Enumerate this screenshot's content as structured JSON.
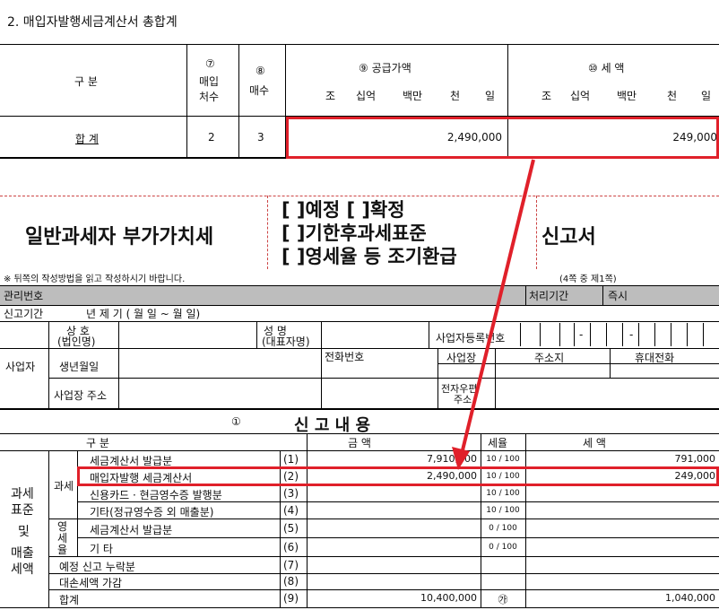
{
  "section_title": "2. 매입자발행세금계산서 총합계",
  "summary_table": {
    "col_category": "구  분",
    "col7_num": "⑦",
    "col7_label_1": "매입",
    "col7_label_2": "처수",
    "col8_num": "⑧",
    "col8_label": "매수",
    "col9_label": "⑨ 공급가액",
    "col10_label": "⑩ 세  액",
    "units": [
      "조",
      "십억",
      "백만",
      "천",
      "일"
    ],
    "row_label": "합  계",
    "row_vendors": "2",
    "row_count": "3",
    "row_supply": "2,490,000",
    "row_tax": "249,000"
  },
  "form_title": {
    "left": "일반과세자 부가가치세",
    "opt1": "[ ]예정 [ ]확정",
    "opt2": "[ ]기한후과세표준",
    "opt3": "[ ]영세율 등 조기환급",
    "right": "신고서"
  },
  "notice": "※ 뒤쪽의 작성방법을 읽고 작성하시기 바랍니다.",
  "page_info": "(4쪽 중 제1쪽)",
  "mgmt_no": "관리번호",
  "proc_period": "처리기간",
  "proc_value": "즉시",
  "period_label": "신고기간",
  "period_value": "년  제  기 (    월    일 ~    월    일)",
  "business": {
    "label": "사업자",
    "trade_name_1": "상  호",
    "trade_name_2": "(법인명)",
    "rep_1": "성    명",
    "rep_2": "(대표자명)",
    "reg_no": "사업자등록번호",
    "birth": "생년월일",
    "phone": "전화번호",
    "office": "사업장",
    "address_col": "주소지",
    "mobile": "휴대전화",
    "addr": "사업장 주소",
    "email_1": "전자우편",
    "email_2": "주소"
  },
  "report": {
    "circle": "①",
    "title": "신   고   내   용",
    "col_category": "구           분",
    "col_amount": "금       액",
    "col_rate": "세율",
    "col_tax": "세       액",
    "group_label_1": "과세",
    "group_label_2": "표준",
    "group_label_3": "및",
    "group_label_4": "매출",
    "group_label_5": "세액",
    "sub_taxable": "과세",
    "sub_zero_1": "영",
    "sub_zero_2": "세",
    "sub_zero_3": "율",
    "rows": [
      {
        "label": "세금계산서 발급분",
        "no": "(1)",
        "amount": "7,910,000",
        "rate": "10 / 100",
        "tax": "791,000"
      },
      {
        "label": "매입자발행 세금계산서",
        "no": "(2)",
        "amount": "2,490,000",
        "rate": "10 / 100",
        "tax": "249,000"
      },
      {
        "label": "신용카드 · 현금영수증 발행분",
        "no": "(3)",
        "amount": "",
        "rate": "10 / 100",
        "tax": ""
      },
      {
        "label": "기타(정규영수증 외 매출분)",
        "no": "(4)",
        "amount": "",
        "rate": "10 / 100",
        "tax": ""
      },
      {
        "label": "세금계산서 발급분",
        "no": "(5)",
        "amount": "",
        "rate": "0 / 100",
        "tax": ""
      },
      {
        "label": "기                   타",
        "no": "(6)",
        "amount": "",
        "rate": "0 / 100",
        "tax": ""
      },
      {
        "label": "예정 신고 누락분",
        "no": "(7)",
        "amount": "",
        "rate": "",
        "tax": ""
      },
      {
        "label": "대손세액 가감",
        "no": "(8)",
        "amount": "",
        "rate": "",
        "tax": ""
      },
      {
        "label": "합계",
        "no": "(9)",
        "amount": "10,400,000",
        "rate": "㉮",
        "tax": "1,040,000"
      }
    ]
  },
  "colors": {
    "highlight": "#e0202a",
    "header_gray": "#bdbdbd"
  }
}
